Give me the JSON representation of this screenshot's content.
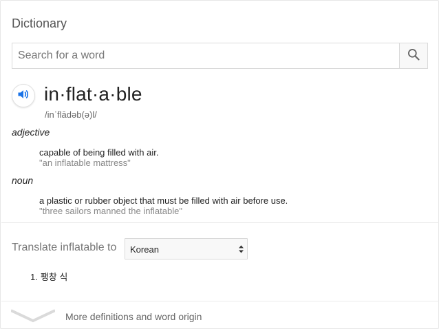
{
  "header": {
    "title": "Dictionary"
  },
  "search": {
    "placeholder": "Search for a word",
    "value": ""
  },
  "entry": {
    "headword": "in·flat·a·ble",
    "phonetic": "/inˈflādəb(ə)l/",
    "senses": [
      {
        "part_of_speech": "adjective",
        "definition": "capable of being filled with air.",
        "example": "\"an inflatable mattress\""
      },
      {
        "part_of_speech": "noun",
        "definition": "a plastic or rubber object that must be filled with air before use.",
        "example": "\"three sailors manned the inflatable\""
      }
    ]
  },
  "translate": {
    "label": "Translate inflatable to",
    "selected_language": "Korean",
    "results": [
      {
        "number": "1.",
        "text": "팽창 식"
      }
    ]
  },
  "more": {
    "label": "More definitions and word origin"
  },
  "icons": {
    "search": "search-icon",
    "speaker": "speaker-icon",
    "dropdown": "updown-arrows-icon",
    "expand": "chevron-down-icon"
  },
  "colors": {
    "speaker_blue": "#1a73e8",
    "muted_text": "#777777",
    "example_text": "#878787"
  }
}
